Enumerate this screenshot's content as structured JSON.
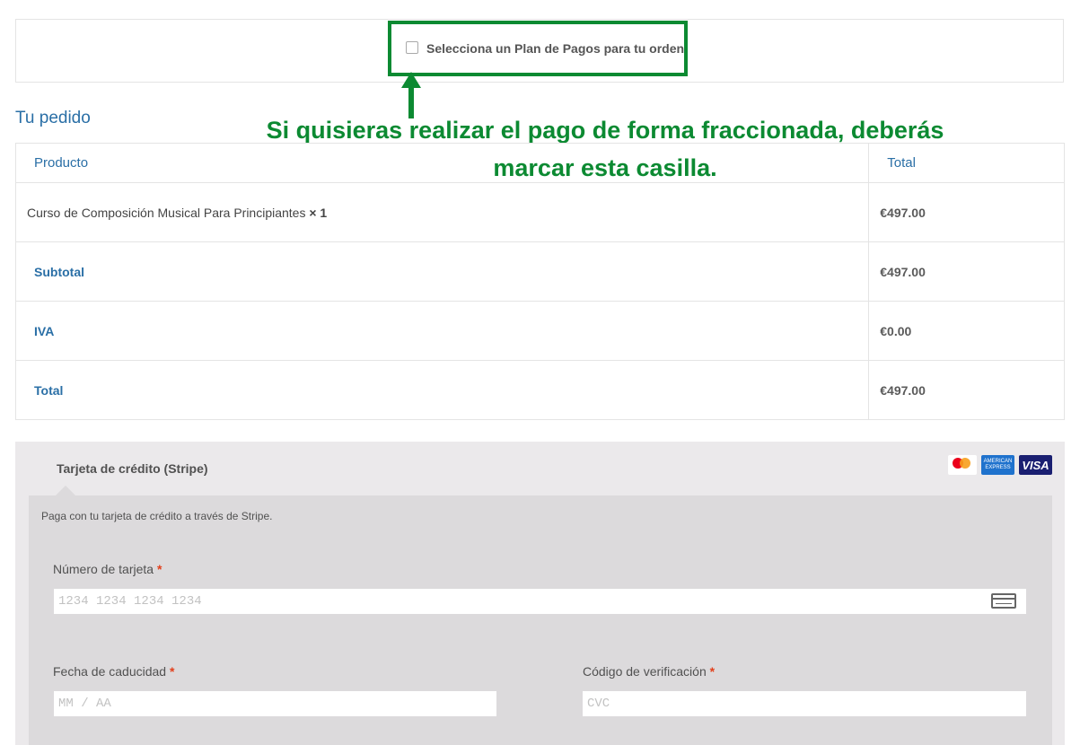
{
  "plan": {
    "label": "Selecciona un Plan de Pagos para tu orden",
    "checked": false
  },
  "annotation": {
    "line1": "Si quisieras realizar el pago de forma fraccionada, deberás",
    "line2": "marcar esta casilla."
  },
  "order": {
    "title": "Tu pedido",
    "headers": {
      "product": "Producto",
      "total": "Total"
    },
    "item": {
      "name": "Curso de Composición Musical Para Principiantes",
      "qty": "× 1",
      "price": "€497.00"
    },
    "subtotal": {
      "label": "Subtotal",
      "value": "€497.00"
    },
    "tax": {
      "label": "IVA",
      "value": "€0.00"
    },
    "total": {
      "label": "Total",
      "value": "€497.00"
    }
  },
  "payment": {
    "method_label": "Tarjeta de crédito (Stripe)",
    "description": "Paga con tu tarjeta de crédito a través de Stripe.",
    "logos": {
      "amex": "AMERICAN EXPRESS",
      "visa": "VISA"
    },
    "card_number": {
      "label": "Número de tarjeta",
      "placeholder": "1234 1234 1234 1234"
    },
    "expiry": {
      "label": "Fecha de caducidad",
      "placeholder": "MM / AA"
    },
    "cvc": {
      "label": "Código de verificación",
      "placeholder": "CVC"
    },
    "required_mark": "*"
  },
  "colors": {
    "annotation_green": "#0c8a32",
    "link_blue": "#2a6fa6",
    "required_red": "#e2401c"
  }
}
